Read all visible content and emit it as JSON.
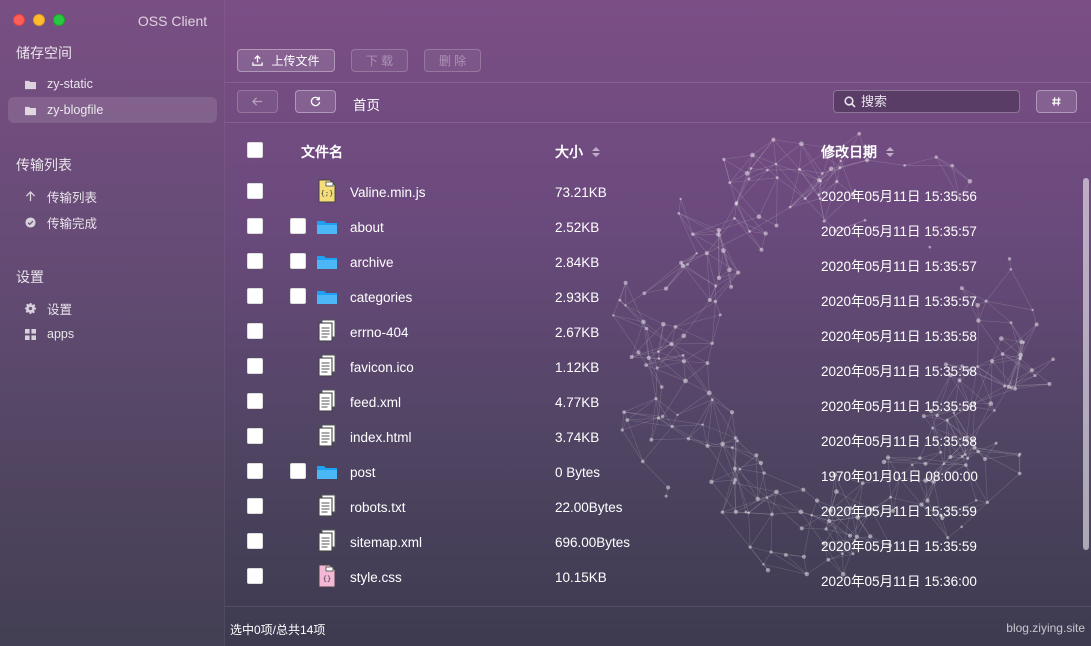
{
  "app": {
    "title": "OSS Client"
  },
  "sidebar": {
    "sections": [
      {
        "title": "储存空间",
        "items": [
          {
            "label": "zy-static",
            "icon": "folder-icon"
          },
          {
            "label": "zy-blogfile",
            "icon": "folder-icon",
            "active": true
          }
        ]
      },
      {
        "title": "传输列表",
        "items": [
          {
            "label": "传输列表",
            "icon": "arrow-up-icon"
          },
          {
            "label": "传输完成",
            "icon": "check-circle-icon"
          }
        ]
      },
      {
        "title": "设置",
        "items": [
          {
            "label": "设置",
            "icon": "gear-icon"
          },
          {
            "label": "apps",
            "icon": "grid-icon"
          }
        ]
      }
    ]
  },
  "toolbar": {
    "upload_label": "上传文件",
    "download_label": "下 载",
    "delete_label": "删 除"
  },
  "nav": {
    "breadcrumb": "首页",
    "search_placeholder": "搜索"
  },
  "table": {
    "headers": {
      "name": "文件名",
      "size": "大小",
      "modified": "修改日期"
    },
    "rows": [
      {
        "name": "Valine.min.js",
        "size": "73.21KB",
        "modified": "2020年05月11日 15:35:56",
        "type": "js"
      },
      {
        "name": "about",
        "size": "2.52KB",
        "modified": "2020年05月11日 15:35:57",
        "type": "folder"
      },
      {
        "name": "archive",
        "size": "2.84KB",
        "modified": "2020年05月11日 15:35:57",
        "type": "folder"
      },
      {
        "name": "categories",
        "size": "2.93KB",
        "modified": "2020年05月11日 15:35:57",
        "type": "folder"
      },
      {
        "name": "errno-404",
        "size": "2.67KB",
        "modified": "2020年05月11日 15:35:58",
        "type": "file"
      },
      {
        "name": "favicon.ico",
        "size": "1.12KB",
        "modified": "2020年05月11日 15:35:58",
        "type": "file"
      },
      {
        "name": "feed.xml",
        "size": "4.77KB",
        "modified": "2020年05月11日 15:35:58",
        "type": "file"
      },
      {
        "name": "index.html",
        "size": "3.74KB",
        "modified": "2020年05月11日 15:35:58",
        "type": "file"
      },
      {
        "name": "post",
        "size": "0 Bytes",
        "modified": "1970年01月01日 08:00:00",
        "type": "folder"
      },
      {
        "name": "robots.txt",
        "size": "22.00Bytes",
        "modified": "2020年05月11日 15:35:59",
        "type": "file"
      },
      {
        "name": "sitemap.xml",
        "size": "696.00Bytes",
        "modified": "2020年05月11日 15:35:59",
        "type": "file"
      },
      {
        "name": "style.css",
        "size": "10.15KB",
        "modified": "2020年05月11日 15:36:00",
        "type": "css"
      }
    ]
  },
  "status": {
    "selection": "选中0项/总共14项",
    "site": "blog.ziying.site"
  },
  "colors": {
    "folder": "#1ea1f2",
    "js_file": "#f5de7a",
    "css_file": "#f4b8d6",
    "close": "#fe5f57",
    "minimize": "#febc2e",
    "maximize": "#28c840"
  }
}
